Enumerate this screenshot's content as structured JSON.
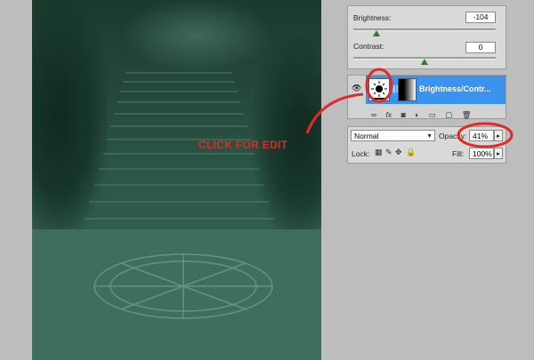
{
  "canvas": {
    "description_icon": "stone-staircase-photo"
  },
  "adjustments": {
    "brightness_label": "Brightness:",
    "brightness_value": "-104",
    "contrast_label": "Contrast:",
    "contrast_value": "0"
  },
  "layers": {
    "visibility_icon": "eye-icon",
    "adjustment_icon": "sun-icon",
    "layer_name": "Brightness/Contr...",
    "bottom_icons": [
      "link-icon",
      "fx-icon",
      "mask-icon",
      "adjustment-icon",
      "folder-icon",
      "new-layer-icon",
      "trash-icon"
    ],
    "bottom_labels": [
      "∞",
      "fx",
      "◙",
      "◐",
      "▭",
      "▢",
      "🗑"
    ]
  },
  "blend": {
    "mode": "Normal",
    "opacity_label": "Opacity:",
    "opacity_value": "41%",
    "lock_label": "Lock:",
    "fill_label": "Fill:",
    "fill_value": "100%"
  },
  "annotation": {
    "text": "CLICK FOR EDIT",
    "color": "#e02a2a"
  }
}
